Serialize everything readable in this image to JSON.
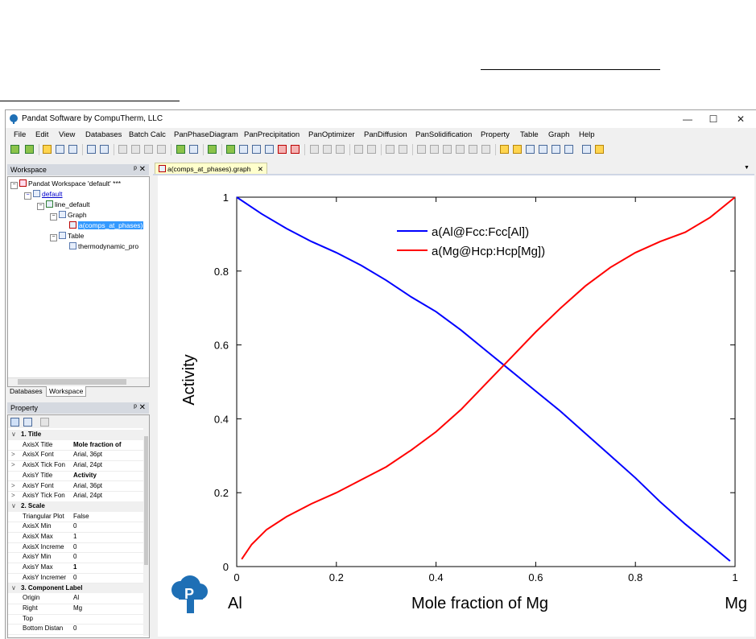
{
  "window": {
    "title": "Pandat Software by CompuTherm, LLC",
    "minimize": "—",
    "maximize": "☐",
    "close": "✕"
  },
  "menu": [
    "File",
    "Edit",
    "View",
    "Databases",
    "Batch Calc",
    "PanPhaseDiagram",
    "PanPrecipitation",
    "PanOptimizer",
    "PanDiffusion",
    "PanSolidification",
    "Property",
    "Table",
    "Graph",
    "Help"
  ],
  "workspace": {
    "header": "Workspace",
    "controls": "ᵖ ✕",
    "tree": {
      "root": "Pandat Workspace 'default' ***",
      "project": "default",
      "line": "line_default",
      "graph": "Graph",
      "graph_item": "a(comps_at_phases)",
      "table": "Table",
      "table_item": "thermodynamic_pro"
    },
    "tabs": [
      "Databases",
      "Workspace"
    ]
  },
  "property": {
    "header": "Property",
    "controls": "ᵖ ✕",
    "rows": [
      {
        "type": "cat",
        "exp": "∨",
        "name": "1. Title"
      },
      {
        "type": "row",
        "exp": "",
        "name": "AxisX Title",
        "value": "Mole fraction of",
        "bold": true
      },
      {
        "type": "row",
        "exp": ">",
        "name": "AxisX Font",
        "value": "Arial, 36pt"
      },
      {
        "type": "row",
        "exp": ">",
        "name": "AxisX Tick Fon",
        "value": "Arial, 24pt"
      },
      {
        "type": "row",
        "exp": "",
        "name": "AxisY Title",
        "value": "Activity",
        "bold": true
      },
      {
        "type": "row",
        "exp": ">",
        "name": "AxisY Font",
        "value": "Arial, 36pt"
      },
      {
        "type": "row",
        "exp": ">",
        "name": "AxisY Tick Fon",
        "value": "Arial, 24pt"
      },
      {
        "type": "cat",
        "exp": "∨",
        "name": "2. Scale"
      },
      {
        "type": "row",
        "exp": "",
        "name": "Triangular Plot",
        "value": "False"
      },
      {
        "type": "row",
        "exp": "",
        "name": "AxisX Min",
        "value": "0"
      },
      {
        "type": "row",
        "exp": "",
        "name": "AxisX Max",
        "value": "1"
      },
      {
        "type": "row",
        "exp": "",
        "name": "AxisX Increme",
        "value": "0"
      },
      {
        "type": "row",
        "exp": "",
        "name": "AxisY Min",
        "value": "0"
      },
      {
        "type": "row",
        "exp": "",
        "name": "AxisY Max",
        "value": "1",
        "bold": true
      },
      {
        "type": "row",
        "exp": "",
        "name": "AxisY Incremer",
        "value": "0"
      },
      {
        "type": "cat",
        "exp": "∨",
        "name": "3. Component Label"
      },
      {
        "type": "row",
        "exp": "",
        "name": "Origin",
        "value": "Al"
      },
      {
        "type": "row",
        "exp": "",
        "name": "Right",
        "value": "Mg"
      },
      {
        "type": "row",
        "exp": "",
        "name": "Top",
        "value": ""
      },
      {
        "type": "row",
        "exp": "",
        "name": "Bottom Distan",
        "value": "0"
      }
    ]
  },
  "document_tab": {
    "label": "a(comps_at_phases).graph",
    "close": "✕"
  },
  "chart_data": {
    "type": "line",
    "xlabel": "Mole fraction of Mg",
    "ylabel": "Activity",
    "xlim": [
      0,
      1
    ],
    "ylim": [
      0,
      1
    ],
    "x_ticks": [
      "0",
      "0.2",
      "0.4",
      "0.6",
      "0.8",
      "1"
    ],
    "y_ticks": [
      "0",
      "0.2",
      "0.4",
      "0.6",
      "0.8",
      "1"
    ],
    "left_component": "Al",
    "right_component": "Mg",
    "legend_position": "top-center",
    "grid": false,
    "series": [
      {
        "name": "a(Al@Fcc:Fcc[Al])",
        "color": "#0000ff",
        "x": [
          0.0,
          0.05,
          0.1,
          0.15,
          0.2,
          0.25,
          0.3,
          0.35,
          0.4,
          0.45,
          0.5,
          0.55,
          0.6,
          0.65,
          0.7,
          0.75,
          0.8,
          0.85,
          0.9,
          0.95,
          0.99
        ],
        "y": [
          1.0,
          0.955,
          0.915,
          0.88,
          0.85,
          0.815,
          0.775,
          0.73,
          0.69,
          0.64,
          0.585,
          0.53,
          0.475,
          0.42,
          0.36,
          0.3,
          0.24,
          0.175,
          0.115,
          0.06,
          0.015
        ]
      },
      {
        "name": "a(Mg@Hcp:Hcp[Mg])",
        "color": "#ff0000",
        "x": [
          0.01,
          0.03,
          0.06,
          0.1,
          0.15,
          0.2,
          0.25,
          0.3,
          0.35,
          0.4,
          0.45,
          0.5,
          0.55,
          0.6,
          0.65,
          0.7,
          0.75,
          0.8,
          0.85,
          0.9,
          0.95,
          1.0
        ],
        "y": [
          0.02,
          0.06,
          0.1,
          0.135,
          0.17,
          0.2,
          0.235,
          0.27,
          0.315,
          0.365,
          0.425,
          0.495,
          0.565,
          0.635,
          0.7,
          0.76,
          0.81,
          0.85,
          0.88,
          0.905,
          0.945,
          1.0
        ]
      }
    ]
  }
}
